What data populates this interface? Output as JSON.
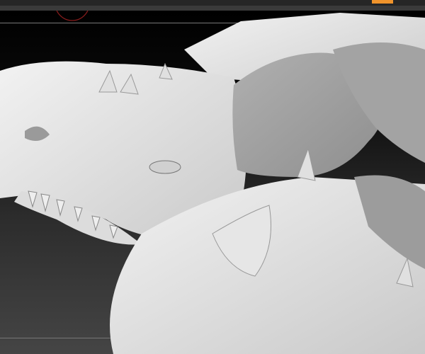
{
  "app": {
    "accent_color": "#f0932b"
  },
  "viewport": {
    "subject": "sculpted-dragon-head",
    "brush_cursor_color": "#8a1c1c"
  }
}
